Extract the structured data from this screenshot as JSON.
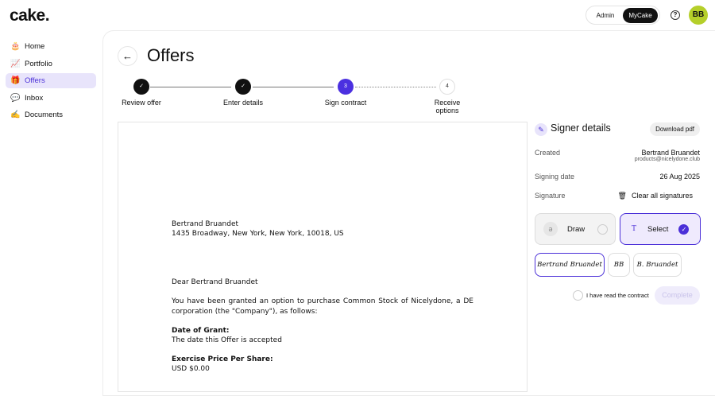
{
  "app": {
    "logo": "cake."
  },
  "header": {
    "modes": [
      "Admin",
      "MyCake"
    ],
    "active_mode": "MyCake",
    "help_icon": "?",
    "avatar": "BB"
  },
  "sidebar": {
    "items": [
      {
        "label": "Home",
        "icon": "🎂"
      },
      {
        "label": "Portfolio",
        "icon": "📈"
      },
      {
        "label": "Offers",
        "icon": "🎁"
      },
      {
        "label": "Inbox",
        "icon": "💬"
      },
      {
        "label": "Documents",
        "icon": "✍"
      }
    ]
  },
  "page": {
    "title": "Offers",
    "back_icon": "←"
  },
  "stepper": [
    {
      "label": "Review offer",
      "mark": "✓",
      "state": "done"
    },
    {
      "label": "Enter details",
      "mark": "✓",
      "state": "done"
    },
    {
      "label": "Sign contract",
      "mark": "3",
      "state": "current"
    },
    {
      "label": "Receive options",
      "mark": "4",
      "state": "todo"
    }
  ],
  "document": {
    "name": "Bertrand Bruandet",
    "address": "1435 Broadway, New York, New York, 10018, US",
    "greeting": "Dear Bertrand Bruandet",
    "intro": "You have been granted an option to purchase Common Stock of Nicelydone, a DE corporation (the \"Company\"), as follows:",
    "date_label": "Date of Grant:",
    "date_value": "The date this Offer is accepted",
    "price_label": "Exercise Price Per Share:",
    "price_value": "USD $0.00"
  },
  "signer": {
    "title": "Signer details",
    "download": "Download pdf",
    "created_label": "Created",
    "created_name": "Bertrand Bruandet",
    "created_email": "products@nicelydone.club",
    "signing_label": "Signing date",
    "signing_date": "26 Aug 2025",
    "signature_label": "Signature",
    "clear": "Clear all signatures",
    "draw": "Draw",
    "select": "Select",
    "options": [
      "Bertrand Bruandet",
      "BB",
      "B. Bruandet"
    ],
    "read_label": "I have read the contract",
    "complete": "Complete"
  },
  "colors": {
    "accent": "#4b30d8",
    "avatar": "#b5cf2a"
  }
}
